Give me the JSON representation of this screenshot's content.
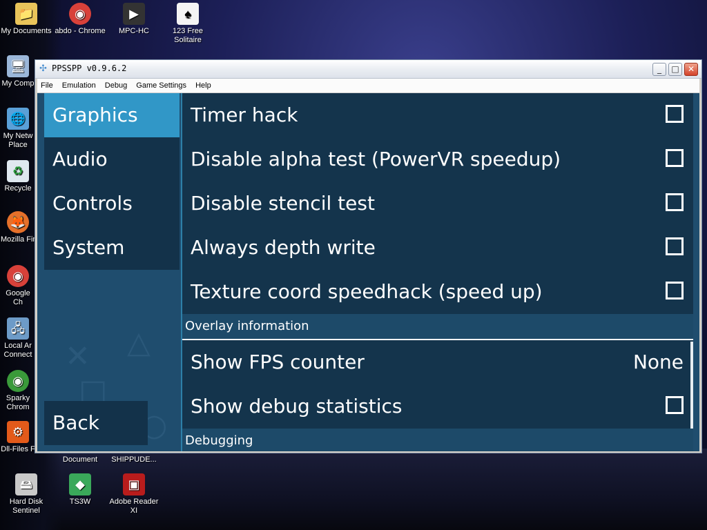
{
  "desktop": {
    "icons": [
      {
        "label": "My Documents",
        "glyph": "📁"
      },
      {
        "label": "abdo - Chrome",
        "glyph": "◉"
      },
      {
        "label": "MPC-HC",
        "glyph": "▶"
      },
      {
        "label": "123 Free Solitaire",
        "glyph": "♠"
      },
      {
        "label": "My Comp",
        "glyph": "🖥"
      },
      {
        "label": "My Netw Place",
        "glyph": "🌐"
      },
      {
        "label": "Recycle",
        "glyph": "♻"
      },
      {
        "label": "Mozilla Fir",
        "glyph": "🦊"
      },
      {
        "label": "Google Ch",
        "glyph": "◉"
      },
      {
        "label": "Local Ar Connect",
        "glyph": "🖧"
      },
      {
        "label": "Sparky Chrom",
        "glyph": "◉"
      },
      {
        "label": "Dll-Files F",
        "glyph": "⚙"
      },
      {
        "label": "Document",
        "glyph": ""
      },
      {
        "label": "SHIPPUDE...",
        "glyph": ""
      },
      {
        "label": "Hard Disk Sentinel",
        "glyph": "🖴"
      },
      {
        "label": "TS3W",
        "glyph": "◆"
      },
      {
        "label": "Adobe Reader XI",
        "glyph": "▣"
      }
    ]
  },
  "window": {
    "title": "PPSSPP v0.9.6.2",
    "buttons": {
      "minimize": "_",
      "maximize": "□",
      "close": "✕"
    }
  },
  "menubar": {
    "items": [
      "File",
      "Emulation",
      "Debug",
      "Game Settings",
      "Help"
    ]
  },
  "sidebar": {
    "items": [
      {
        "label": "Graphics",
        "active": true
      },
      {
        "label": "Audio",
        "active": false
      },
      {
        "label": "Controls",
        "active": false
      },
      {
        "label": "System",
        "active": false
      }
    ],
    "back_label": "Back"
  },
  "settings": {
    "rows_top": [
      {
        "label": "Timer hack",
        "checked": false
      },
      {
        "label": "Disable alpha test (PowerVR speedup)",
        "checked": false
      },
      {
        "label": "Disable stencil test",
        "checked": false
      },
      {
        "label": "Always depth write",
        "checked": false
      },
      {
        "label": "Texture coord speedhack (speed up)",
        "checked": false
      }
    ],
    "overlay_header": "Overlay information",
    "overlay_rows": [
      {
        "label": "Show FPS counter",
        "value": "None"
      },
      {
        "label": "Show debug statistics",
        "checked": false
      }
    ],
    "debug_header": "Debugging"
  },
  "colors": {
    "active_tab": "#3197c7",
    "panel": "#14344c",
    "client_bg": "#1f4d6e"
  }
}
